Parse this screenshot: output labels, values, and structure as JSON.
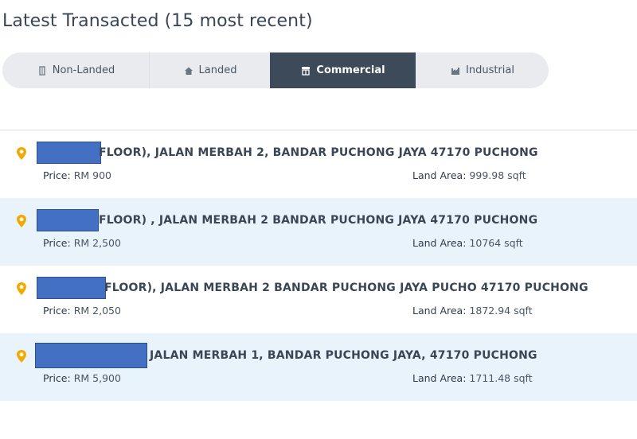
{
  "page_title": "Latest Transacted (15 most recent)",
  "tabs": [
    {
      "label": "Non-Landed",
      "icon": "building-icon",
      "active": false
    },
    {
      "label": "Landed",
      "icon": "house-icon",
      "active": false
    },
    {
      "label": "Commercial",
      "icon": "shop-icon",
      "active": true
    },
    {
      "label": "Industrial",
      "icon": "factory-icon",
      "active": false
    }
  ],
  "colors": {
    "active_tab": "#3c4a59",
    "tab_bar": "#e9ebef",
    "pin": "#f2a900",
    "alt_row": "#e8f3fb",
    "redaction": "#4470c4"
  },
  "transactions": [
    {
      "address": "FLOOR), JALAN MERBAH 2, BANDAR PUCHONG JAYA 47170 PUCHONG",
      "price_label": "Price:",
      "price": "RM 900",
      "area_label": "Land Area:",
      "area": "999.98 sqft"
    },
    {
      "address": "FLOOR) , JALAN MERBAH 2 BANDAR PUCHONG JAYA 47170 PUCHONG",
      "price_label": "Price:",
      "price": "RM 2,500",
      "area_label": "Land Area:",
      "area": "10764 sqft"
    },
    {
      "address": "FLOOR), JALAN MERBAH 2 BANDAR PUCHONG JAYA PUCHO 47170 PUCHONG",
      "price_label": "Price:",
      "price": "RM 2,050",
      "area_label": "Land Area:",
      "area": "1872.94 sqft"
    },
    {
      "address": "JALAN MERBAH 1, BANDAR PUCHONG JAYA, 47170 PUCHONG",
      "price_label": "Price:",
      "price": "RM 5,900",
      "area_label": "Land Area:",
      "area": "1711.48 sqft"
    }
  ]
}
